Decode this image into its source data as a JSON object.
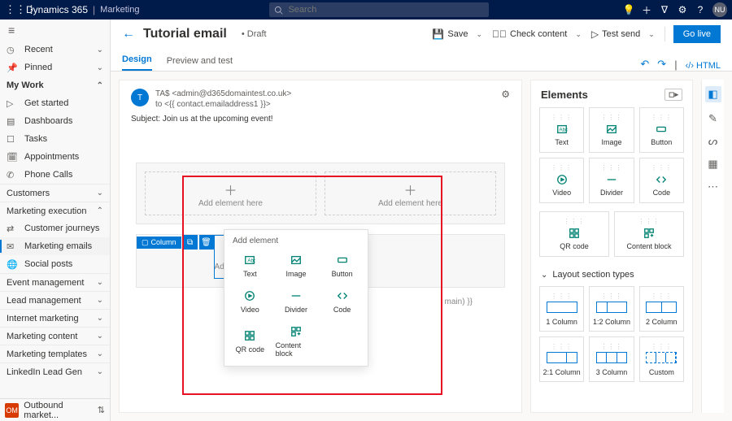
{
  "brand": {
    "product": "Dynamics 365",
    "module": "Marketing"
  },
  "search": {
    "placeholder": "Search"
  },
  "avatar": "NU",
  "sidebar": {
    "recent": "Recent",
    "pinned": "Pinned",
    "mywork": "My Work",
    "items": [
      "Get started",
      "Dashboards",
      "Tasks",
      "Appointments",
      "Phone Calls"
    ],
    "customers": "Customers",
    "mexec": "Marketing execution",
    "mexec_items": [
      "Customer journeys",
      "Marketing emails",
      "Social posts"
    ],
    "groups": [
      "Event management",
      "Lead management",
      "Internet marketing",
      "Marketing content",
      "Marketing templates",
      "LinkedIn Lead Gen"
    ],
    "footer_badge": "OM",
    "footer": "Outbound market..."
  },
  "cmd": {
    "title": "Tutorial email",
    "status": "• Draft",
    "save": "Save",
    "check": "Check content",
    "test": "Test send",
    "golive": "Go live"
  },
  "tabs": {
    "design": "Design",
    "preview": "Preview and test",
    "html": "HTML"
  },
  "email": {
    "av": "T",
    "from": "TA$  <admin@d365domaintest.co.uk>",
    "to": "to  <{{ contact.emailaddress1 }}>",
    "subject_label": "Subject:",
    "subject": "Join us at the upcoming event!",
    "addelem": "Add element here",
    "column_tag": "Column",
    "trailing": "main) }}"
  },
  "popup": {
    "title": "Add element",
    "items": [
      "Text",
      "Image",
      "Button",
      "Video",
      "Divider",
      "Code",
      "QR code",
      "Content block"
    ]
  },
  "elements": {
    "title": "Elements",
    "items": [
      "Text",
      "Image",
      "Button",
      "Video",
      "Divider",
      "Code",
      "QR code",
      "Content block"
    ],
    "layout_title": "Layout section types",
    "layouts": [
      "1 Column",
      "1:2 Column",
      "2 Column",
      "2:1 Column",
      "3 Column",
      "Custom"
    ]
  }
}
